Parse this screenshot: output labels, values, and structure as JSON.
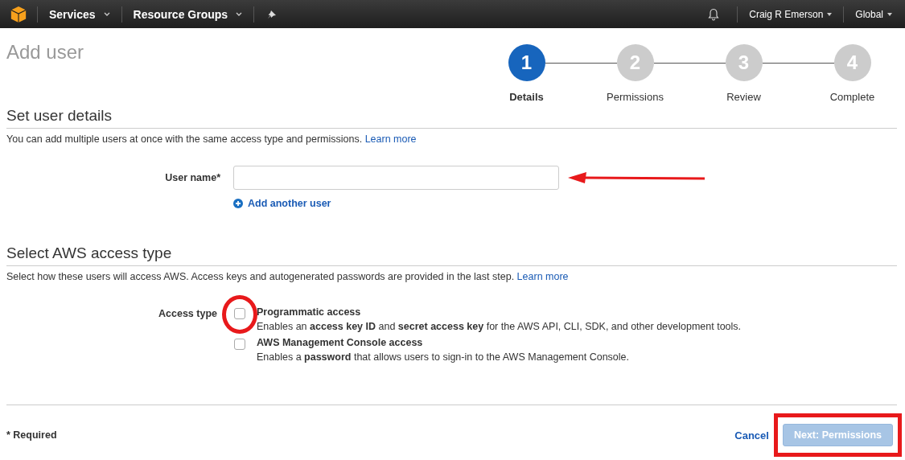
{
  "nav": {
    "services": "Services",
    "resource_groups": "Resource Groups",
    "user": "Craig R Emerson",
    "region": "Global"
  },
  "page_title": "Add user",
  "steps": [
    {
      "number": "1",
      "label": "Details",
      "selected": true
    },
    {
      "number": "2",
      "label": "Permissions",
      "selected": false
    },
    {
      "number": "3",
      "label": "Review",
      "selected": false
    },
    {
      "number": "4",
      "label": "Complete",
      "selected": false
    }
  ],
  "user_details": {
    "heading": "Set user details",
    "description": "You can add multiple users at once with the same access type and permissions.",
    "link": "Learn more",
    "field_label": "User name*",
    "add_user": "Add another user"
  },
  "access": {
    "heading": "Select AWS access type",
    "description": "Select how these users will access AWS. Access keys and autogenerated passwords are provided in the last step.",
    "link": "Learn more",
    "label": "Access type",
    "options": [
      {
        "title": "Programmatic access",
        "description": "Enables an **access key ID** and **secret access key** for the AWS API, CLI, SDK, and other development tools.",
        "checked": false
      },
      {
        "title": "AWS Management Console access",
        "description": "Enables a **password** that allows users to sign-in to the AWS Management Console.",
        "checked": false
      }
    ]
  },
  "footer": {
    "required_note": "* Required",
    "cancel": "Cancel",
    "next": {
      "label": "Next: Permissions",
      "disabled": true
    }
  }
}
